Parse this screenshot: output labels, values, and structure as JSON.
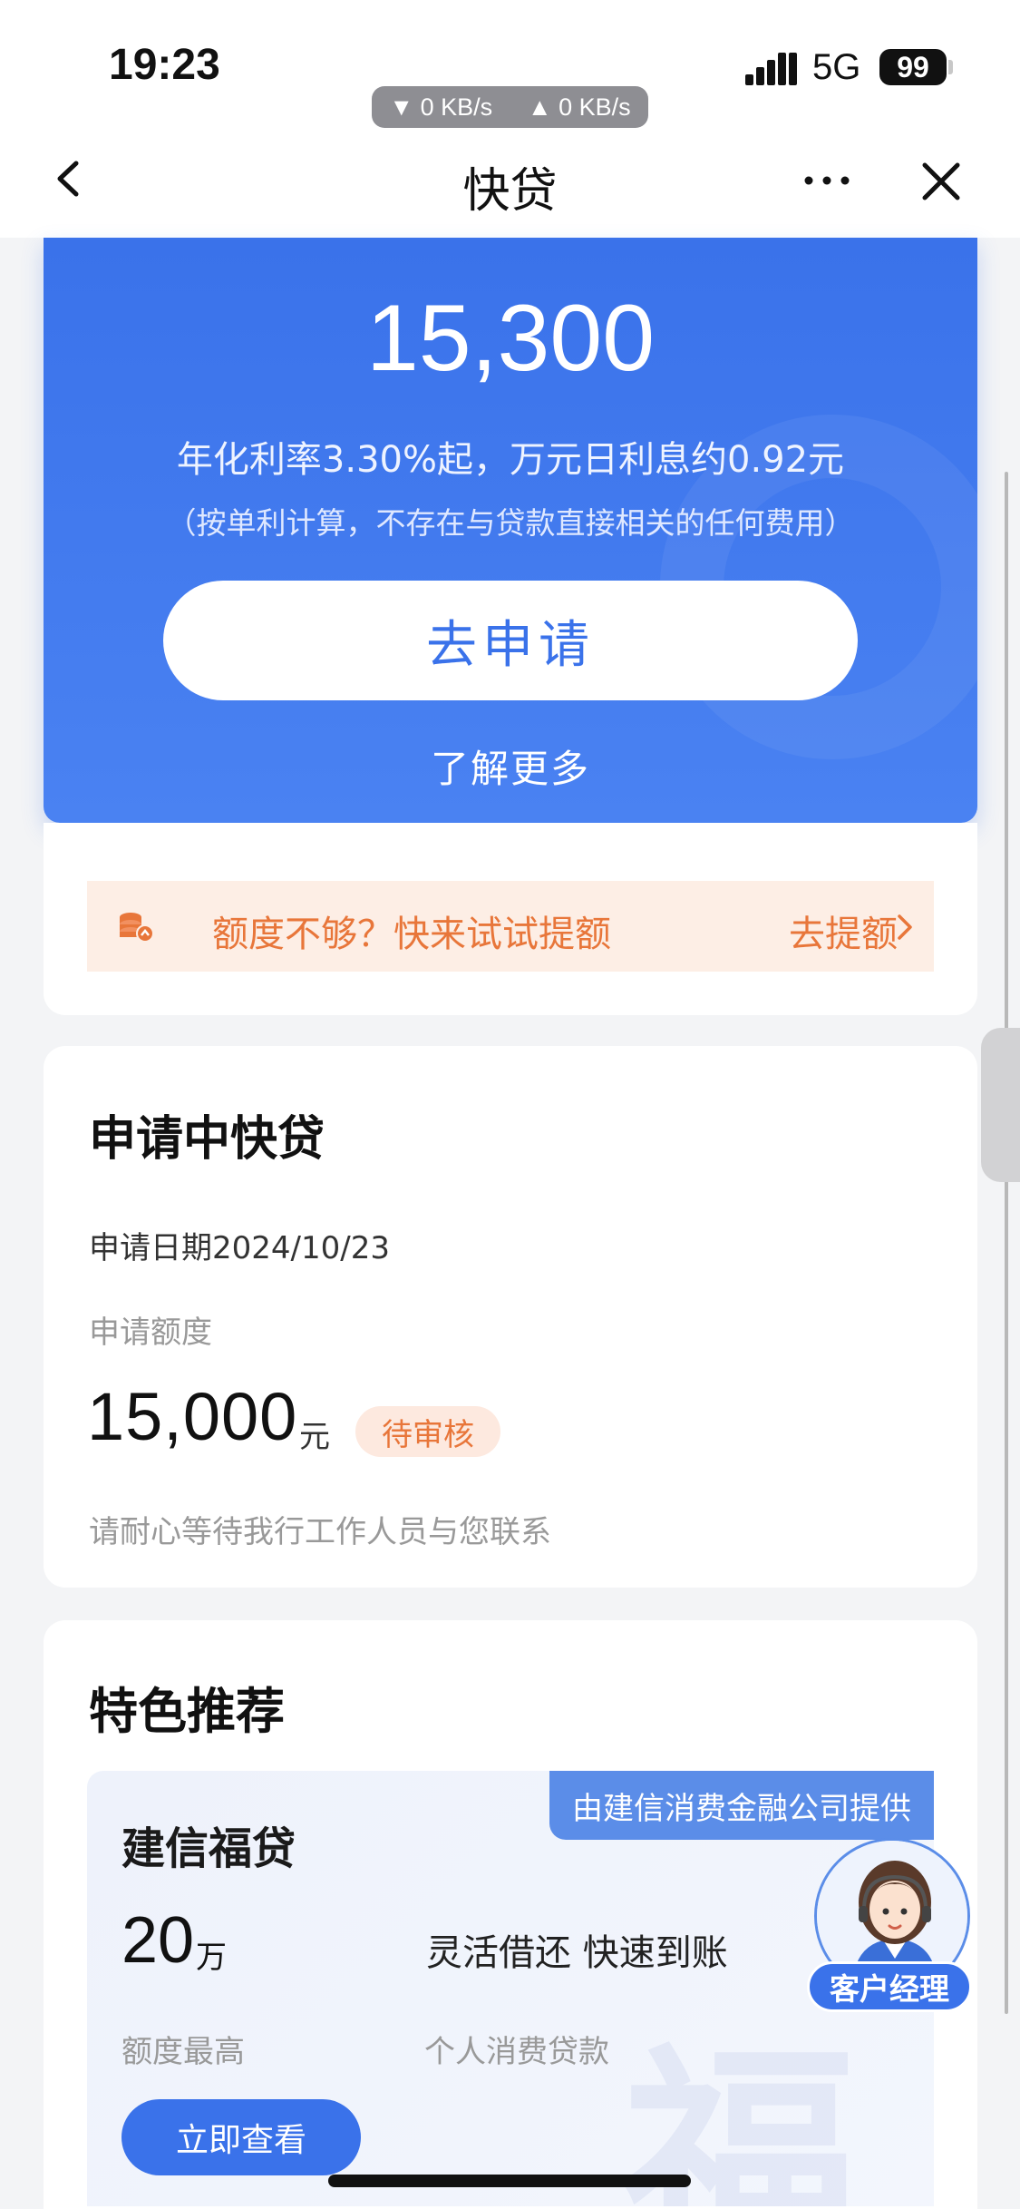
{
  "status_bar": {
    "time": "19:23",
    "download": "▼ 0 KB/s",
    "upload": "▲ 0 KB/s",
    "network": "5G",
    "battery": "99"
  },
  "nav": {
    "back_icon": "chevron-left-icon",
    "title": "快贷",
    "more_icon": "more-dots-icon",
    "close_icon": "close-icon"
  },
  "hero": {
    "amount": "15,300",
    "rate_text": "年化利率3.30%起，万元日利息约0.92元",
    "note": "（按单利计算，不存在与贷款直接相关的任何费用）",
    "apply_button": "去申请",
    "learn_more": "了解更多",
    "accent": "#3a72ea"
  },
  "limit_banner": {
    "icon": "coin-stack-icon",
    "text": "额度不够？快来试试提额",
    "link": "去提额"
  },
  "application": {
    "title": "申请中快贷",
    "date": "申请日期2024/10/23",
    "amount_label": "申请额度",
    "amount": "15,000",
    "unit": "元",
    "status": "待审核",
    "message": "请耐心等待我行工作人员与您联系"
  },
  "featured": {
    "title": "特色推荐",
    "product": {
      "provider_tag": "由建信消费金融公司提供",
      "name": "建信福贷",
      "max_amount": "20",
      "max_unit": "万",
      "max_label": "额度最高",
      "slogan": "灵活借还 快速到账",
      "type": "个人消费贷款",
      "button": "立即查看",
      "watermark": "福"
    }
  },
  "floating_agent": {
    "label": "客户经理"
  }
}
